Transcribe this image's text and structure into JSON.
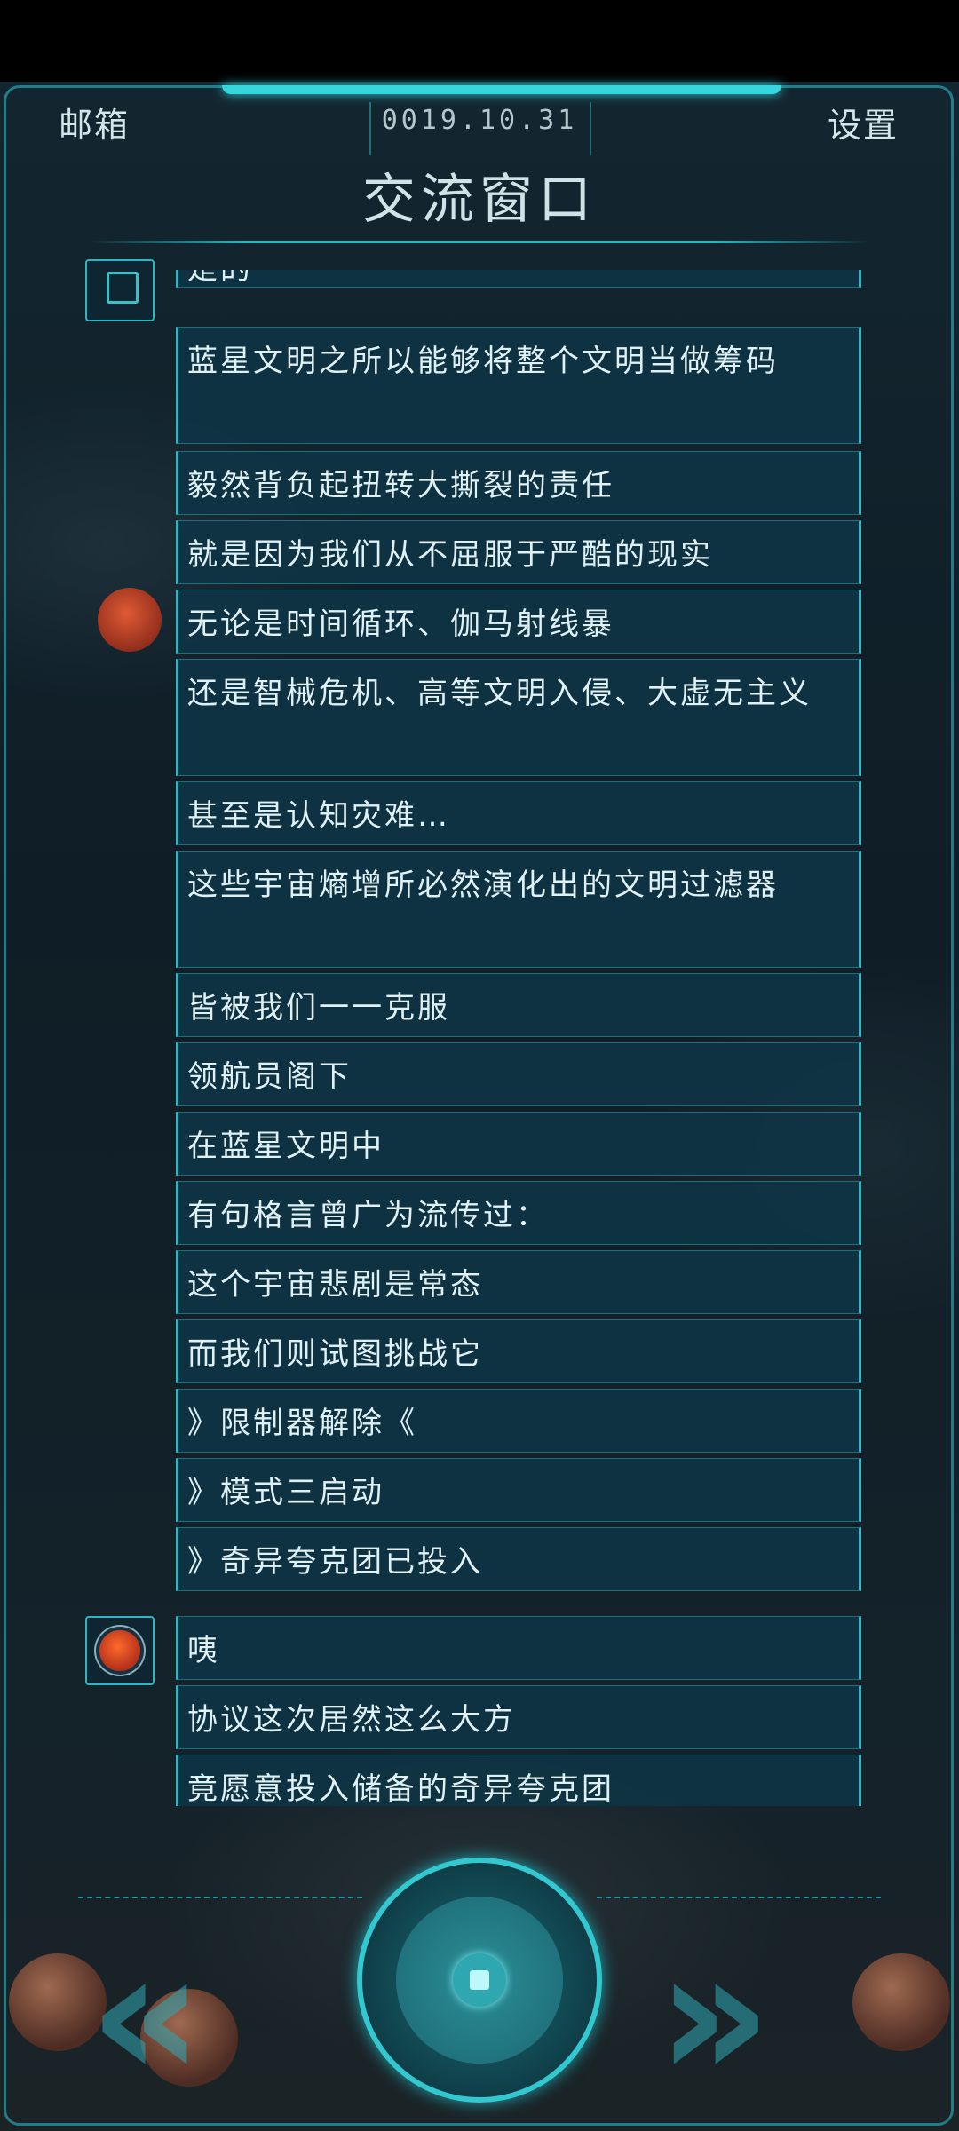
{
  "header": {
    "mail_label": "邮箱",
    "date": "0019.10.31",
    "settings_label": "设置",
    "title": "交流窗口"
  },
  "messages": [
    "是的",
    "蓝星文明之所以能够将整个文明当做筹码",
    "毅然背负起扭转大撕裂的责任",
    "就是因为我们从不屈服于严酷的现实",
    "无论是时间循环、伽马射线暴",
    "还是智械危机、高等文明入侵、大虚无主义",
    "甚至是认知灾难…",
    "这些宇宙熵增所必然演化出的文明过滤器",
    "皆被我们一一克服",
    "领航员阁下",
    "在蓝星文明中",
    "有句格言曾广为流传过：",
    "这个宇宙悲剧是常态",
    "而我们则试图挑战它",
    "》限制器解除《",
    "》模式三启动",
    "》奇异夸克团已投入"
  ],
  "messages_2": [
    "咦",
    "协议这次居然这么大方",
    "竟愿意投入储备的奇异夸克团"
  ],
  "controls": {
    "prev_glyph": "«",
    "next_glyph": "»"
  }
}
